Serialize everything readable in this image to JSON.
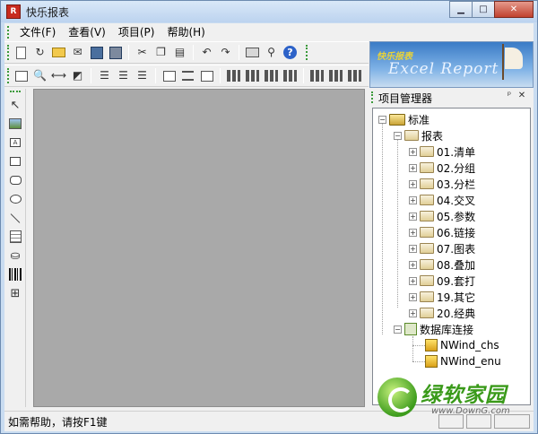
{
  "window": {
    "title": "快乐报表"
  },
  "menu": [
    "文件(F)",
    "查看(V)",
    "项目(P)",
    "帮助(H)"
  ],
  "banner": {
    "cn": "快乐报表",
    "en": "Excel Report"
  },
  "toolbar1_icons": [
    "new-file-icon",
    "open-icon",
    "folder-icon",
    "mail-icon",
    "save-icon",
    "save-all-icon",
    "cut-icon",
    "copy-icon",
    "paste-icon",
    "undo-icon",
    "redo-icon",
    "print-icon",
    "preview-icon",
    "help-icon"
  ],
  "toolbar2_icons": [
    "page-setup-icon",
    "zoom-icon",
    "link-icon",
    "comment-icon",
    "align-left-icon",
    "align-center-icon",
    "align-right-icon",
    "align-top-icon",
    "align-middle-icon",
    "align-bottom-icon",
    "layout-1-icon",
    "layout-2-icon",
    "layout-3-icon",
    "layout-4-icon",
    "layout-5-icon",
    "layout-6-icon",
    "layout-7-icon"
  ],
  "palette": [
    "pointer-icon",
    "image-icon",
    "text-icon",
    "rectangle-icon",
    "rounded-rectangle-icon",
    "ellipse-icon",
    "line-icon",
    "table-icon",
    "shape-icon",
    "barcode-icon",
    "grid-icon"
  ],
  "pane": {
    "title": "项目管理器",
    "pin": "ᵖ",
    "close": "✕"
  },
  "tree": {
    "root": "标准",
    "reports_folder": "报表",
    "reports": [
      "01.清单",
      "02.分组",
      "03.分栏",
      "04.交叉",
      "05.参数",
      "06.链接",
      "07.图表",
      "08.叠加",
      "09.套打",
      "19.其它",
      "20.经典"
    ],
    "db_folder": "数据库连接",
    "connections": [
      "NWind_chs",
      "NWind_enu"
    ]
  },
  "status": {
    "text": "如需帮助，请按F1键"
  },
  "watermark": {
    "text": "绿软家园",
    "url": "www.DownG.com"
  }
}
